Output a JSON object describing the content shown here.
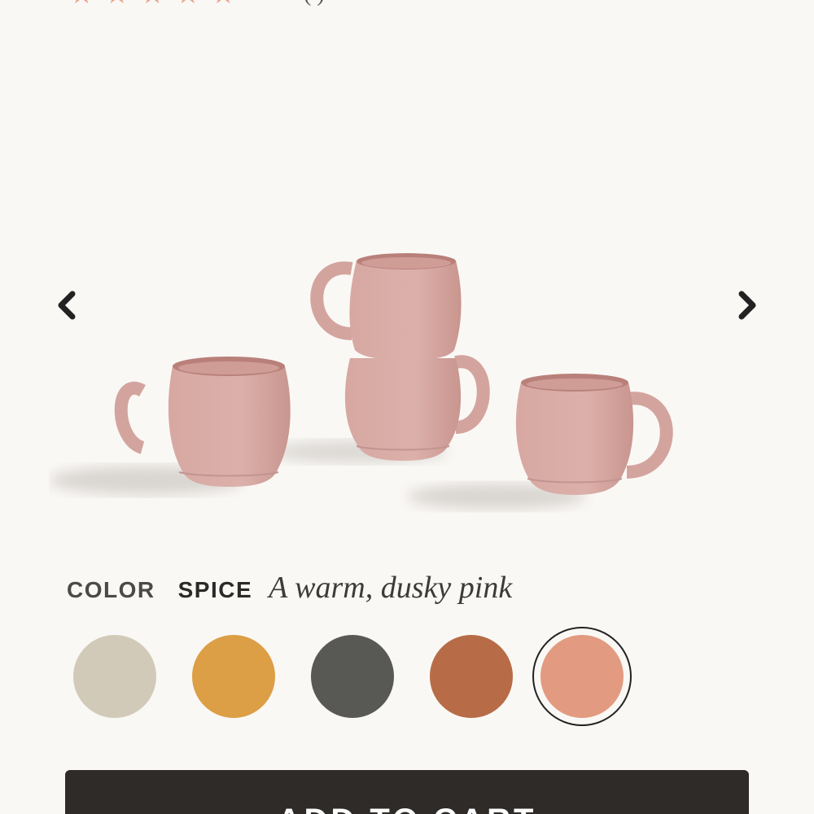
{
  "rating": {
    "stars": 5,
    "review_count_text": "(         )"
  },
  "carousel": {
    "prev_icon": "chevron-left-icon",
    "next_icon": "chevron-right-icon"
  },
  "color": {
    "label": "COLOR",
    "selected_name": "SPICE",
    "description": "A warm, dusky pink",
    "swatches": [
      {
        "hex": "#d1cab8"
      },
      {
        "hex": "#dc9f45"
      },
      {
        "hex": "#585854"
      },
      {
        "hex": "#b76c47"
      },
      {
        "hex": "#e29b80",
        "selected": true
      }
    ]
  },
  "cart": {
    "label": "ADD TO CART"
  },
  "colors": {
    "mug": "#d8aaa4",
    "mug_shade": "#c79893",
    "mug_inner": "#b98079"
  }
}
